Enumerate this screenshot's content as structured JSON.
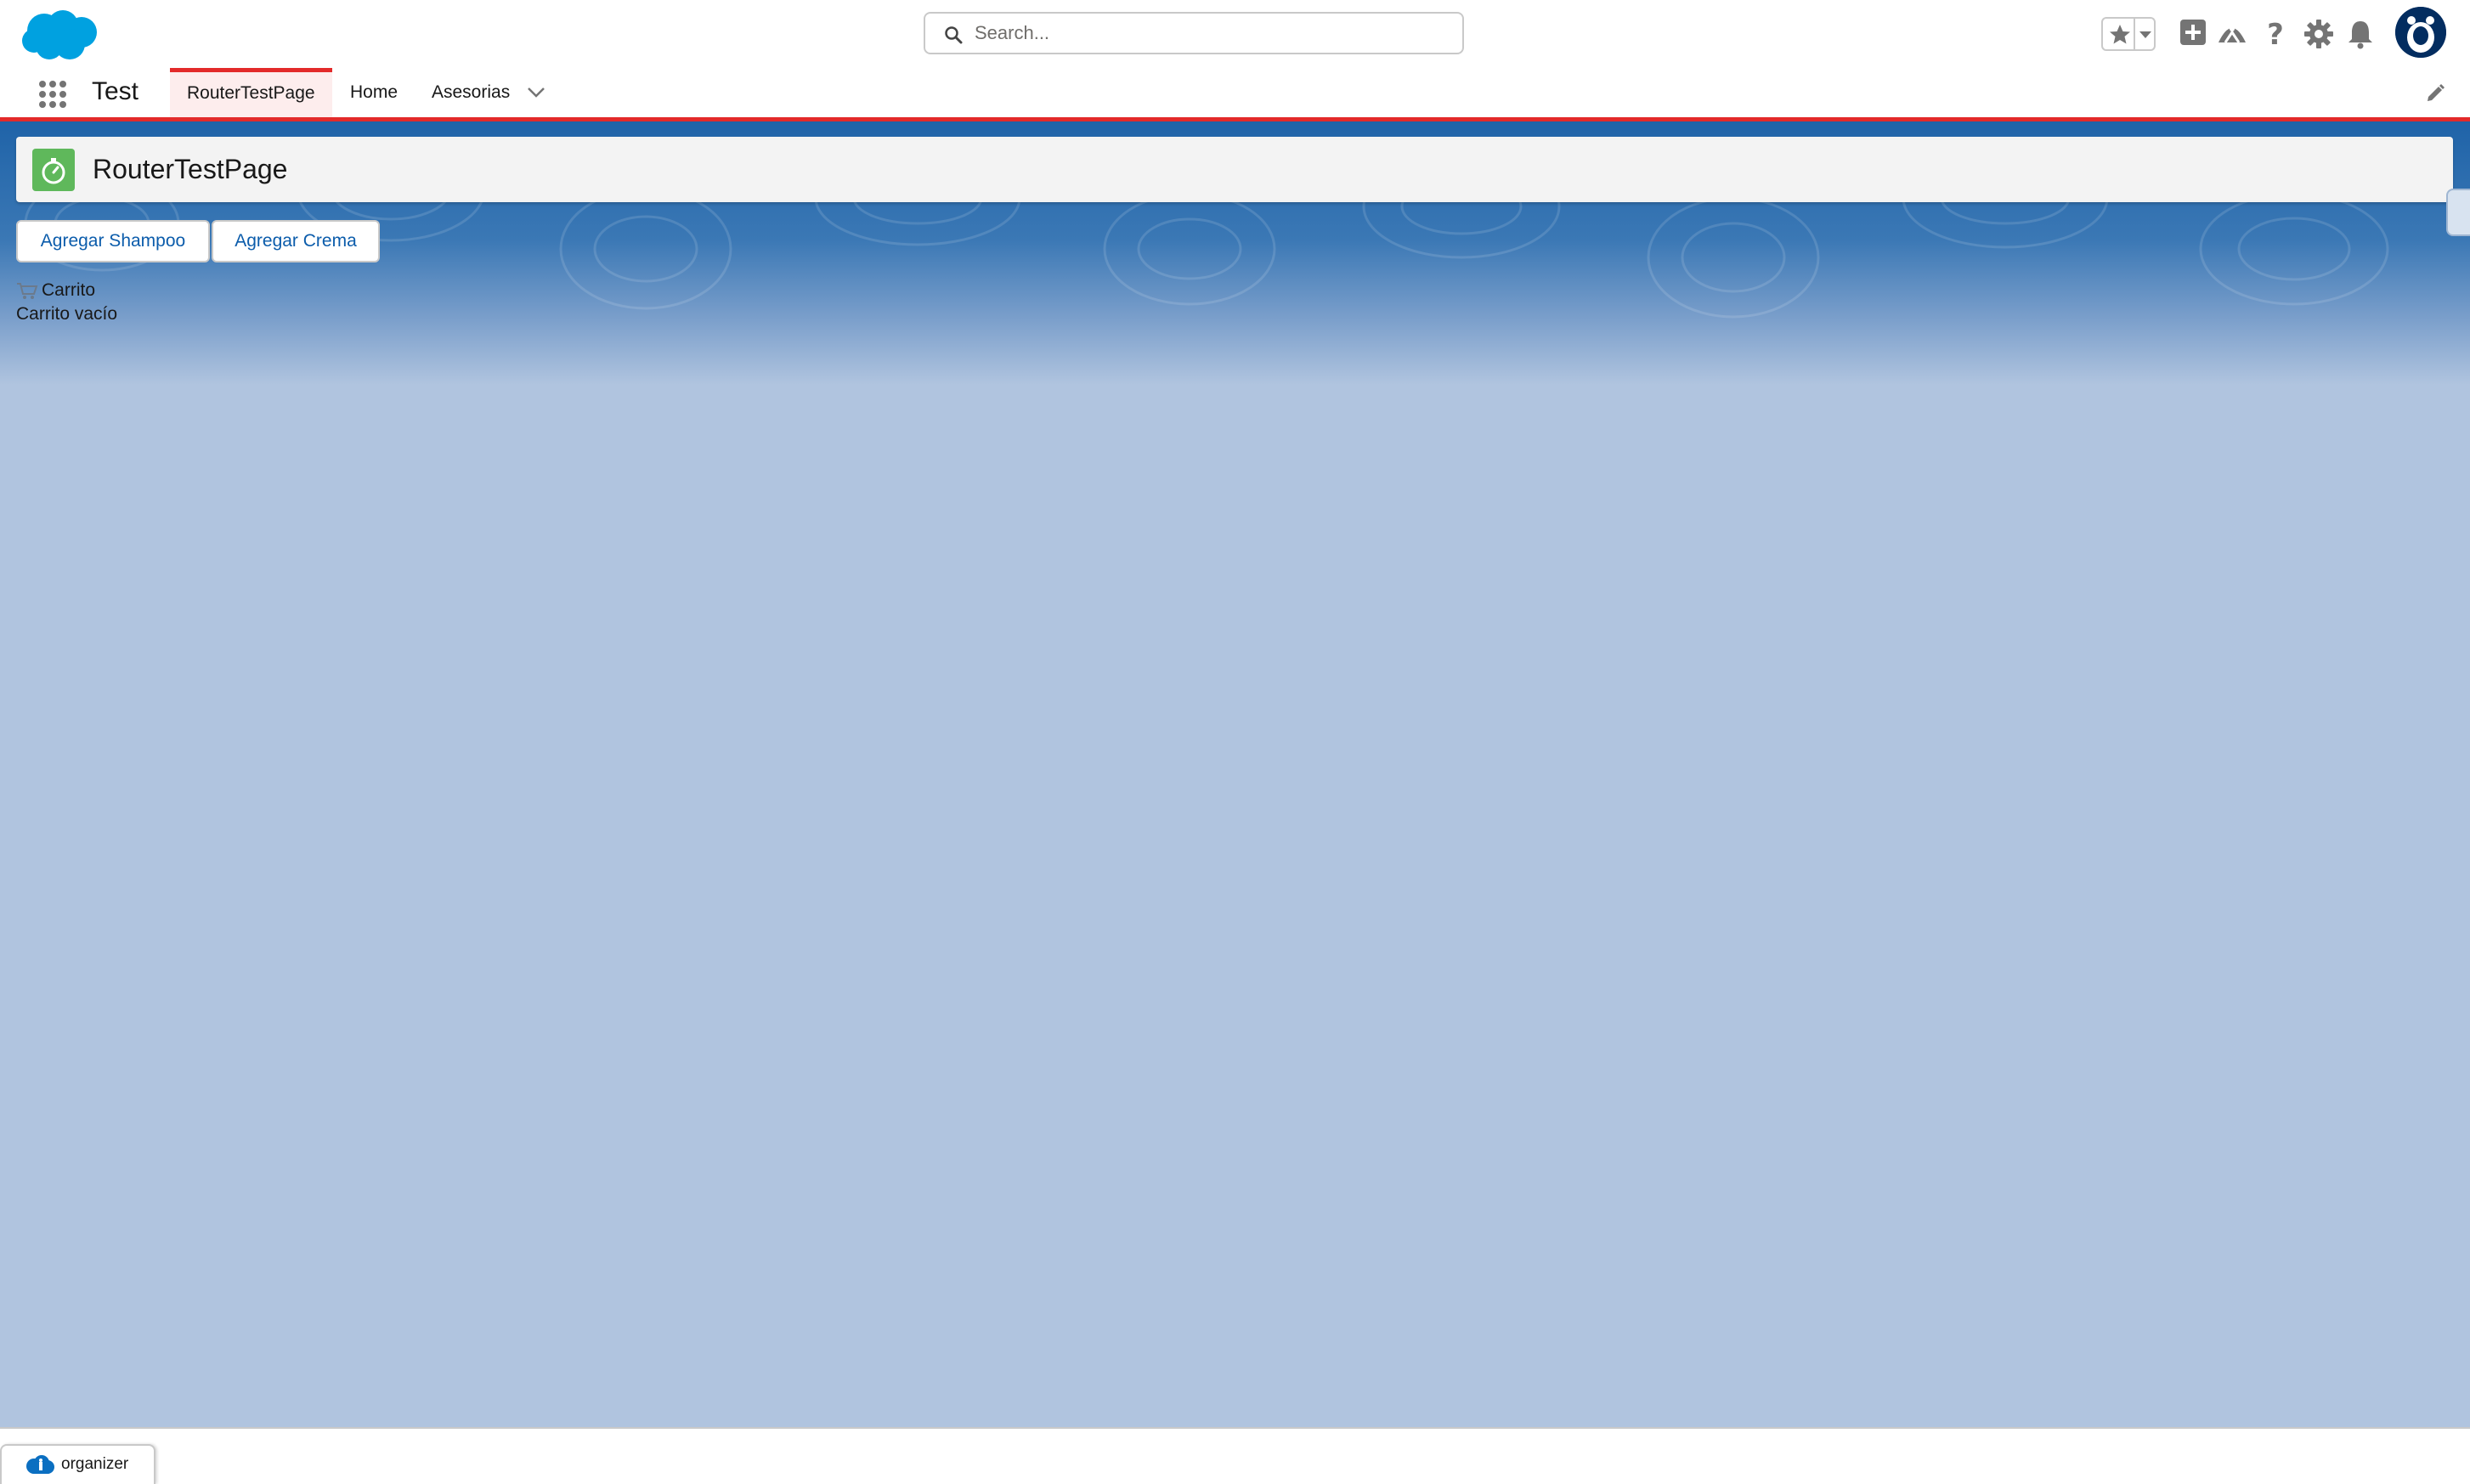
{
  "header": {
    "logo": "salesforce-cloud-logo",
    "search": {
      "placeholder": "Search...",
      "value": ""
    },
    "icons": [
      "favorites-star-icon",
      "favorites-menu-icon",
      "global-actions-icon",
      "trailhead-icon",
      "help-icon",
      "setup-gear-icon",
      "notifications-bell-icon",
      "user-avatar"
    ]
  },
  "nav": {
    "app_name": "Test",
    "tabs": [
      {
        "label": "RouterTestPage",
        "active": true
      },
      {
        "label": "Home",
        "active": false
      },
      {
        "label": "Asesorias",
        "active": false
      }
    ]
  },
  "page": {
    "title": "RouterTestPage",
    "icon": "stopwatch-icon",
    "buttons": {
      "add_shampoo": "Agregar Shampoo",
      "add_cream": "Agregar Crema"
    },
    "cart": {
      "title": "Carrito",
      "status": "Carrito vacío"
    }
  },
  "utility_bar": {
    "label": "organizer"
  },
  "colors": {
    "accent_red": "#e32a2a",
    "brand_blue": "#0b5cab",
    "page_icon_green": "#5fb85b",
    "background": "#b0c4df"
  }
}
